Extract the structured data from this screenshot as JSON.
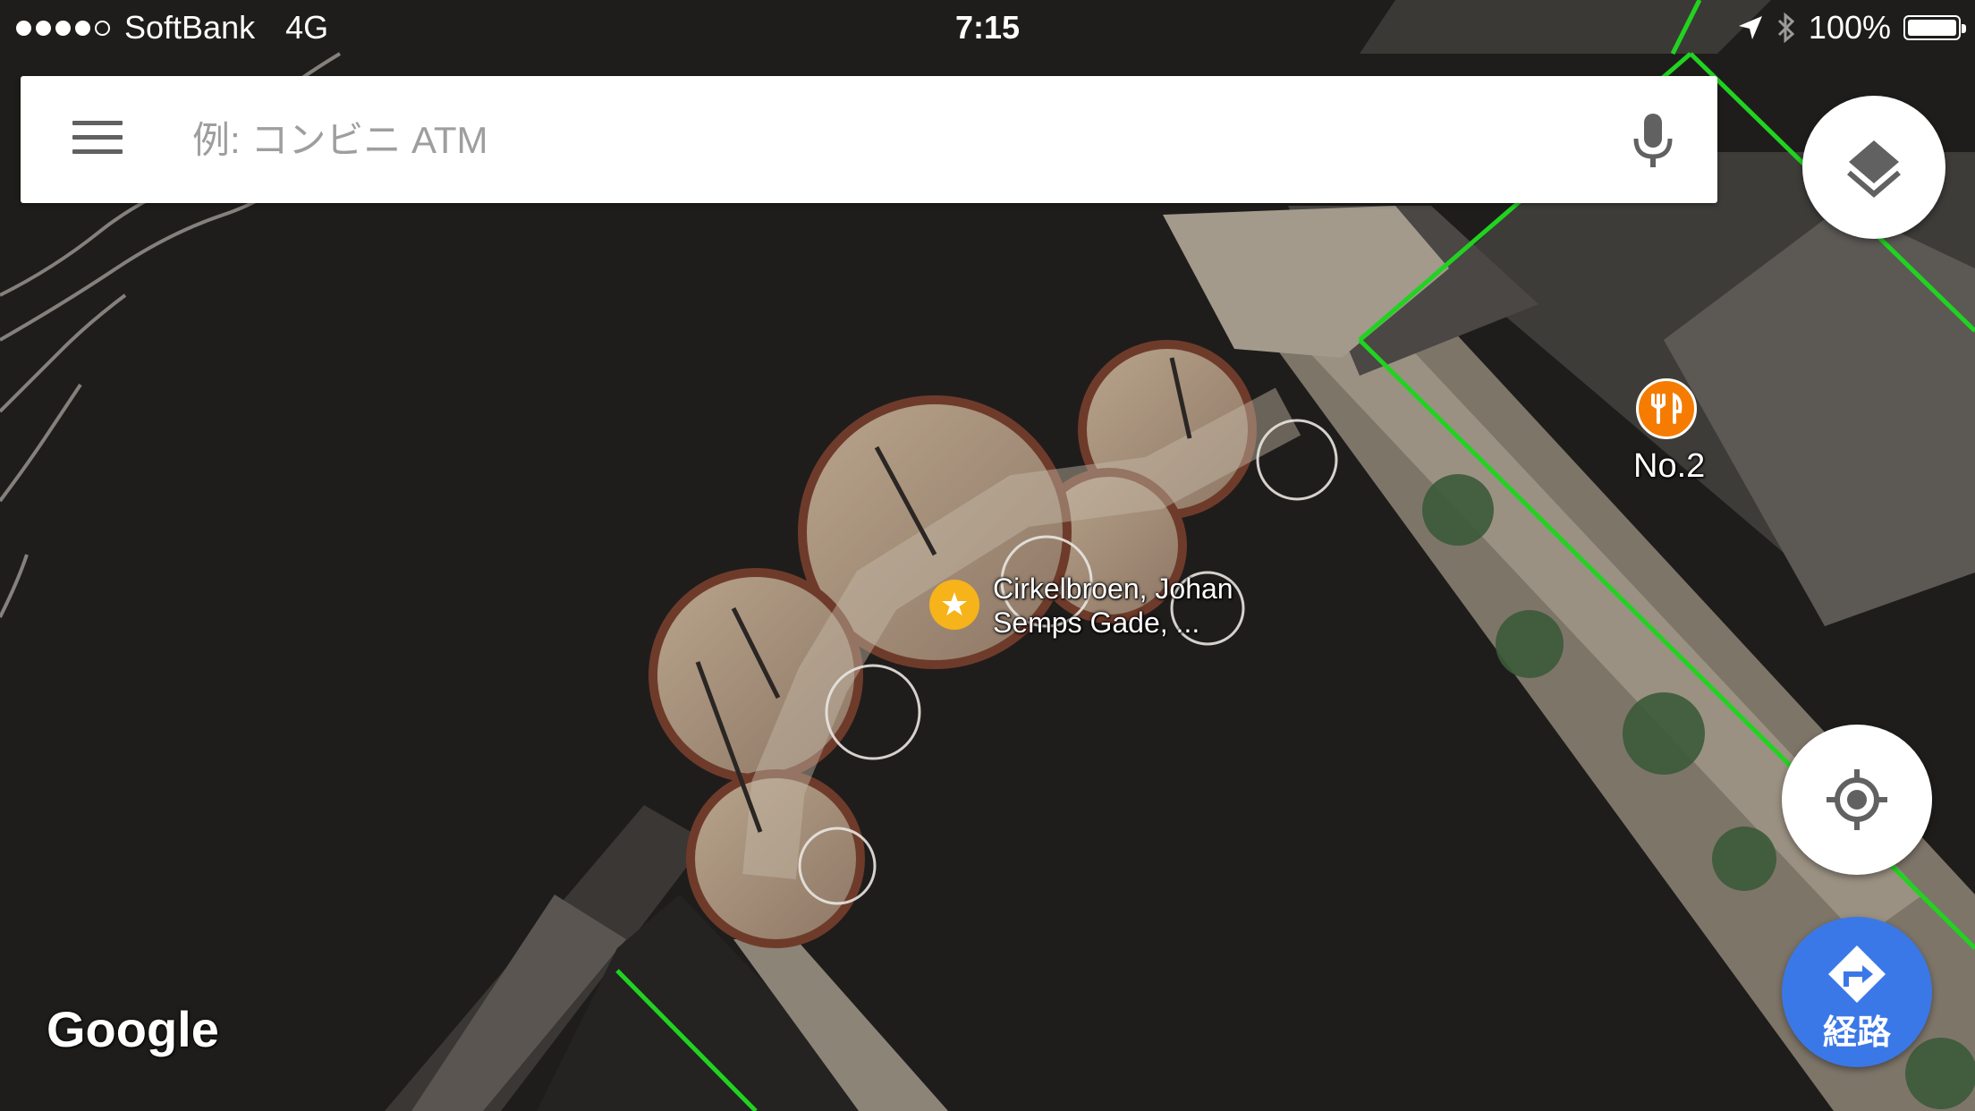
{
  "status_bar": {
    "carrier": "SoftBank",
    "network": "4G",
    "time": "7:15",
    "battery": "100%",
    "signal_bars_filled": 4,
    "signal_bars_total": 5
  },
  "search": {
    "placeholder": "例: コンビニ ATM"
  },
  "map": {
    "attribution": "Google",
    "places": [
      {
        "label": "Cirkelbroen, Johan Semps Gade, ...",
        "label_line1": "Cirkelbroen, Johan",
        "label_line2": "Semps Gade, ...",
        "icon": "star-icon",
        "color": "#f6b31a"
      },
      {
        "label": "No.2",
        "icon": "restaurant-icon",
        "color": "#f57c00"
      }
    ]
  },
  "buttons": {
    "layers_icon": "layers-icon",
    "my_location_icon": "my-location-icon",
    "directions_label": "経路",
    "directions_icon": "directions-icon"
  },
  "colors": {
    "search_bar": "#ffffff",
    "directions_button": "#3b78e7",
    "route_line": "#21d321",
    "water": "#1f1d1b"
  }
}
